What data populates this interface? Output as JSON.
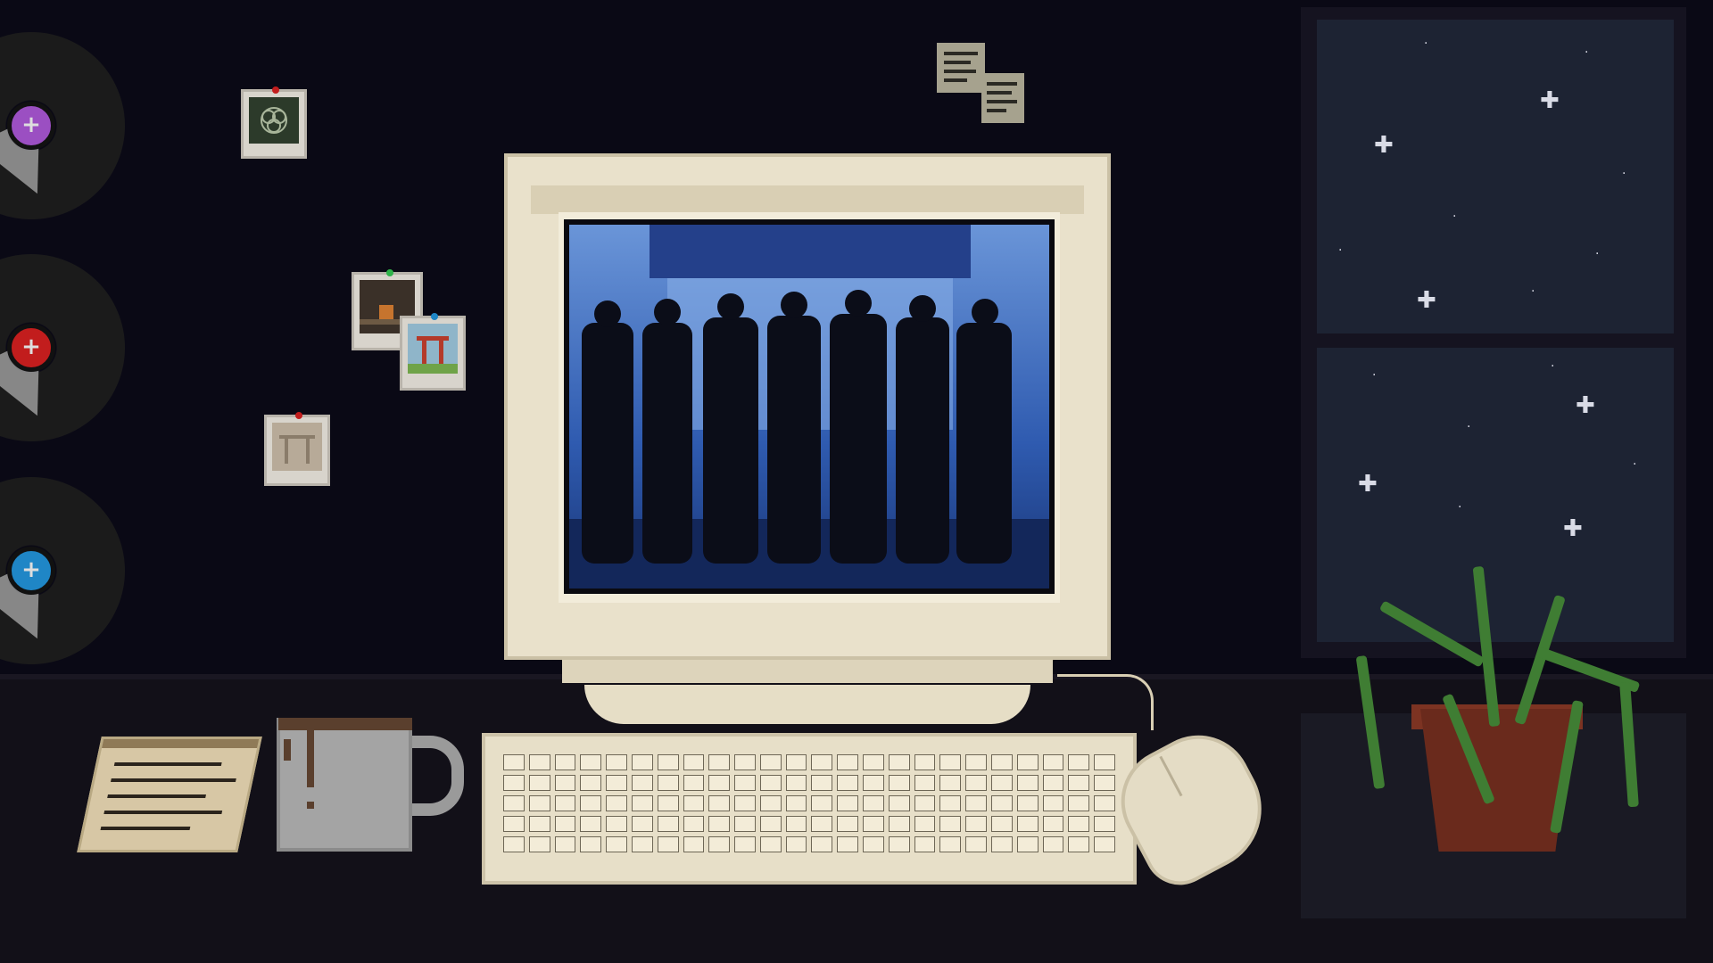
{
  "scene": {
    "type": "pixel-art desk scene",
    "monitor_screen_content": "photo",
    "colors": {
      "wall": "#0a0915",
      "desk": "#121018",
      "monitor_beige": "#e9e1cb",
      "screen_blue": "#1f4aa6",
      "plant_green": "#3f7d33",
      "pot_brown": "#6a2a1c",
      "vinyl_purple": "#9b4fc2",
      "vinyl_red": "#c21d1d",
      "vinyl_blue": "#1f86c6"
    }
  },
  "icons": {
    "vinyl_records": [
      "vinyl-record-purple-icon",
      "vinyl-record-red-icon",
      "vinyl-record-blue-icon"
    ],
    "stars": "star-icon",
    "leds": "led-icon"
  }
}
